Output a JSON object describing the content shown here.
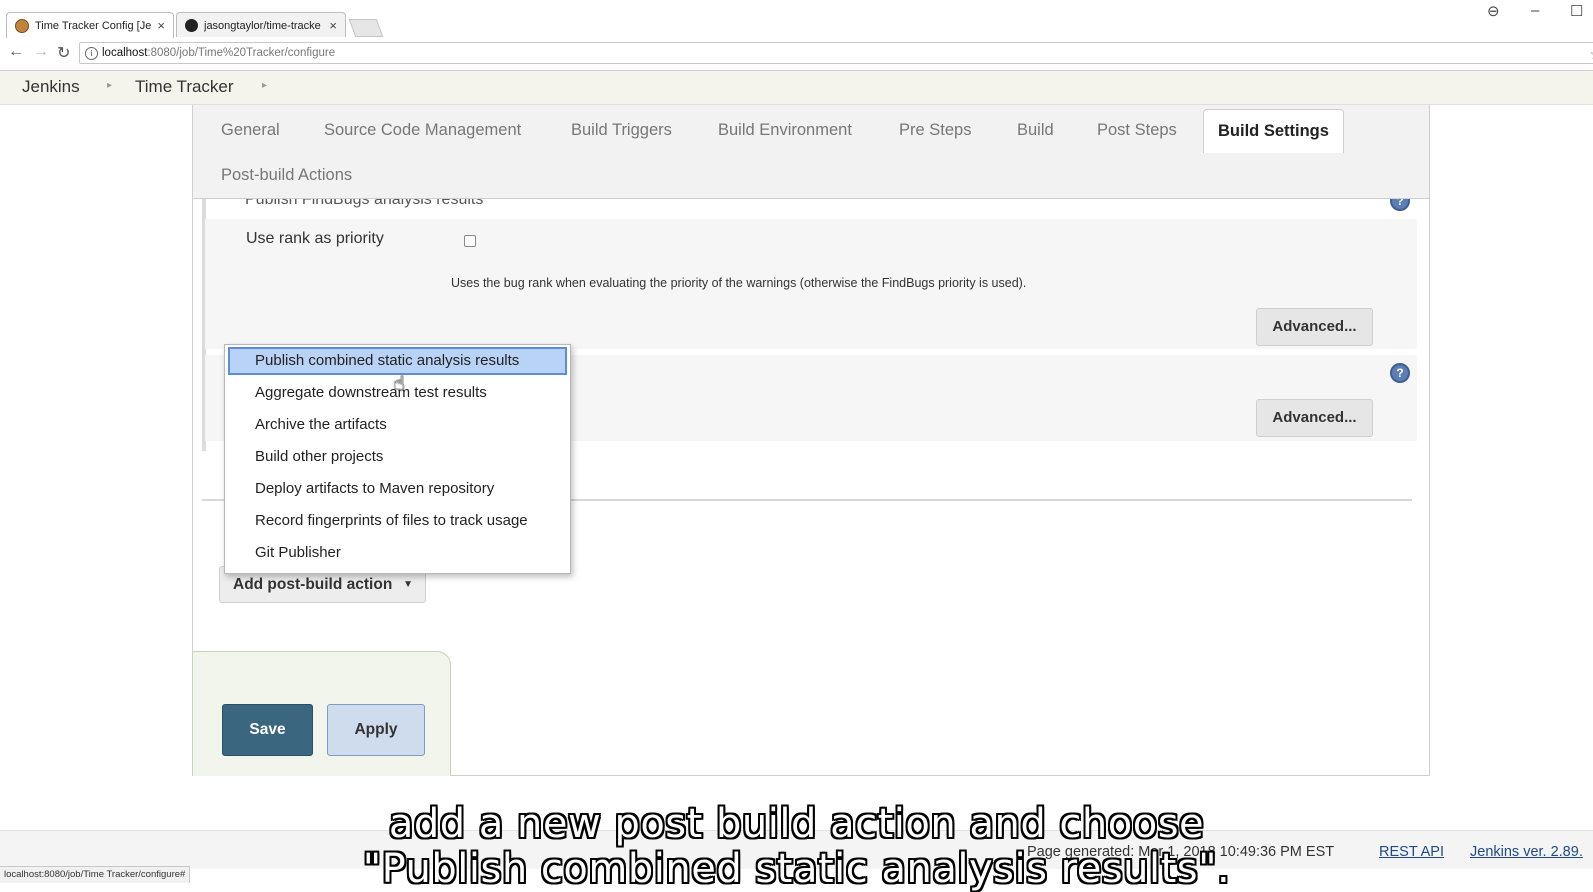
{
  "browser": {
    "tabs": [
      {
        "title": "Time Tracker Config [Jen",
        "close": "×",
        "icon": "jenkins-favicon"
      },
      {
        "title": "jasongtaylor/time-tracke",
        "close": "×",
        "icon": "github-favicon"
      }
    ],
    "url_host": "localhost",
    "url_path": ":8080/job/Time%20Tracker/configure",
    "window_controls": {
      "account": "⊖",
      "minimize": "–",
      "maximize": "☐"
    }
  },
  "breadcrumb": {
    "items": [
      "Jenkins",
      "Time Tracker"
    ],
    "separator": "▸"
  },
  "config_tabs": {
    "tabs": [
      "General",
      "Source Code Management",
      "Build Triggers",
      "Build Environment",
      "Pre Steps",
      "Build",
      "Post Steps",
      "Build Settings",
      "Post-build Actions"
    ],
    "active": "Build Settings"
  },
  "findbugs_section": {
    "title": "Publish FindBugs analysis results",
    "rank_label": "Use rank as priority",
    "rank_checked": false,
    "rank_description": "Uses the bug rank when evaluating the priority of the warnings (otherwise the FindBugs priority is used).",
    "advanced_label": "Advanced..."
  },
  "second_section": {
    "advanced_label": "Advanced..."
  },
  "help_icon_glyph": "?",
  "dropdown": {
    "items": [
      "Publish combined static analysis results",
      "Aggregate downstream test results",
      "Archive the artifacts",
      "Build other projects",
      "Deploy artifacts to Maven repository",
      "Record fingerprints of files to track usage",
      "Git Publisher"
    ],
    "selected": "Publish combined static analysis results"
  },
  "add_post_build_action": {
    "label": "Add post-build action",
    "caret": "▼"
  },
  "buttons": {
    "save": "Save",
    "apply": "Apply"
  },
  "footer": {
    "page_generated": "Page generated: Mar 1, 2018 10:49:36 PM EST",
    "rest_api": "REST API",
    "version": "Jenkins ver. 2.89."
  },
  "status_url": "localhost:8080/job/Time Tracker/configure#",
  "subtitles": {
    "line1": "add a new post build action and choose",
    "line2": "\"Publish combined static analysis results\"."
  }
}
